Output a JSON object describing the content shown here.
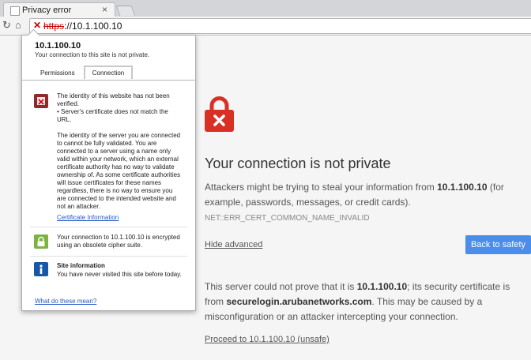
{
  "tab": {
    "title": "Privacy error",
    "close": "×"
  },
  "toolbar": {
    "back": "↻",
    "home": "⌂"
  },
  "address": {
    "scheme": "https",
    "rest": "://10.1.100.10"
  },
  "main": {
    "heading": "Your connection is not private",
    "p1_before": "Attackers might be trying to steal your information from ",
    "p1_host": "10.1.100.10",
    "p1_after": " (for example, passwords, messages, or credit cards). ",
    "p1_code": "NET::ERR_CERT_COMMON_NAME_INVALID",
    "hide_advanced": "Hide advanced",
    "back_to_safety": "Back to safety",
    "p2_a": "This server could not prove that it is ",
    "p2_host": "10.1.100.10",
    "p2_b": "; its security certificate is from ",
    "p2_domain": "securelogin.arubanetworks.com",
    "p2_c": ". This may be caused by a misconfiguration or an attacker intercepting your connection.",
    "proceed": "Proceed to 10.1.100.10 (unsafe)"
  },
  "bubble": {
    "host": "10.1.100.10",
    "subtitle": "Your connection to this site is not private.",
    "tab_permissions": "Permissions",
    "tab_connection": "Connection",
    "identity_text": "The identity of this website has not been verified.\n  • Server's certificate does not match the URL.",
    "identity_detail": "The identity of the server you are connected to cannot be fully validated. You are connected to a server using a name only valid within your network, which an external certificate authority has no way to validate ownership of. As some certificate authorities will issue certificates for these names regardless, there is no way to ensure you are connected to the intended website and not an attacker.",
    "certificate_link": "Certificate Information",
    "encrypted_text": "Your connection to 10.1.100.10 is encrypted using an obsolete cipher suite.",
    "site_info_title": "Site information",
    "site_info_text": "You have never visited this site before today.",
    "what_mean": "What do these mean?"
  },
  "colors": {
    "accent": "#4a8ee9",
    "danger": "#d93025",
    "bubble_border": "#adadad"
  }
}
